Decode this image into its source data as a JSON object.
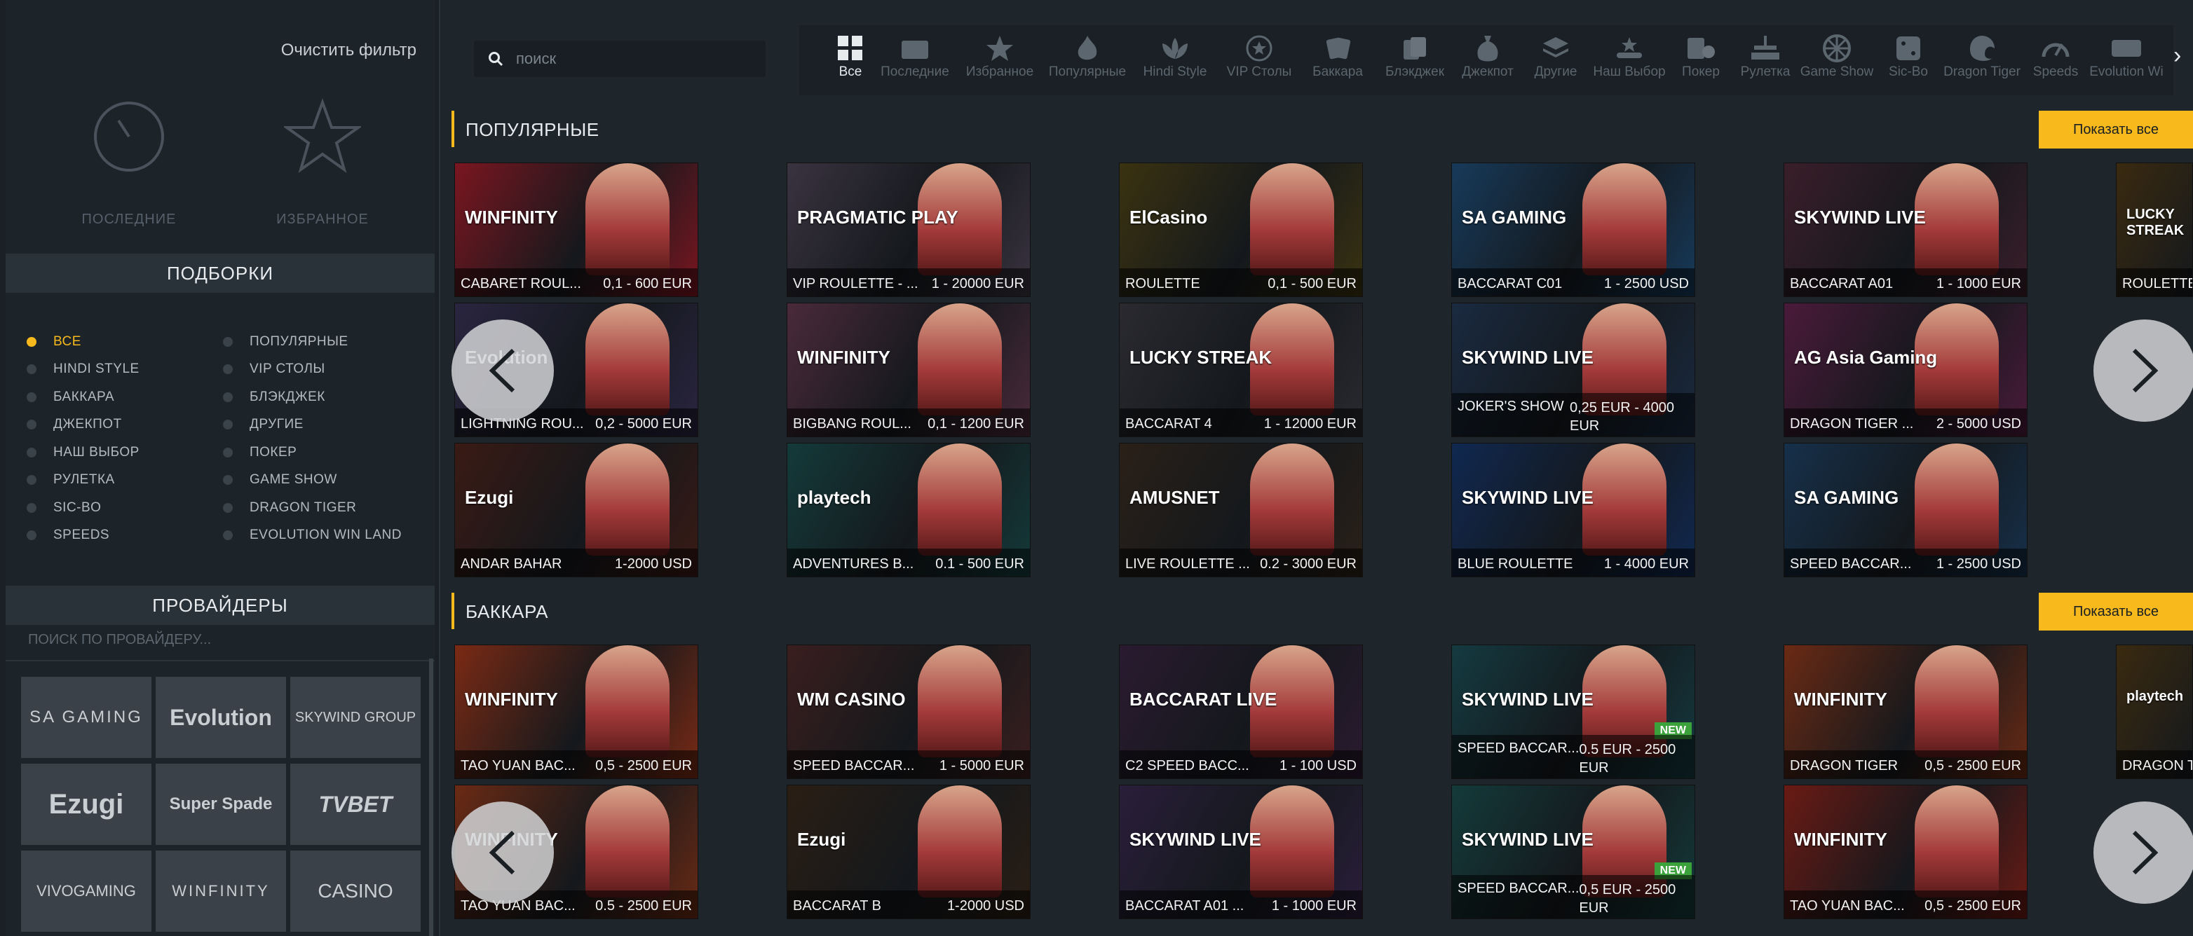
{
  "sidebar": {
    "clear_filter": "Очистить фильтр",
    "recent_label": "ПОСЛЕДНИЕ",
    "favorites_label": "ИЗБРАННОЕ",
    "collections_title": "ПОДБОРКИ",
    "collections_left": [
      "ВСЕ",
      "HINDI STYLE",
      "БАККАРА",
      "ДЖЕКПОТ",
      "НАШ ВЫБОР",
      "РУЛЕТКА",
      "SIC-BO",
      "SPEEDS"
    ],
    "collections_right": [
      "ПОПУЛЯРНЫЕ",
      "VIP СТОЛЫ",
      "БЛЭКДЖЕК",
      "ДРУГИЕ",
      "ПОКЕР",
      "GAME SHOW",
      "DRAGON TIGER",
      "EVOLUTION WIN LAND"
    ],
    "providers_title": "ПРОВАЙДЕРЫ",
    "providers_search_placeholder": "ПОИСК ПО ПРОВАЙДЕРУ...",
    "providers": [
      "SA GAMING",
      "Evolution",
      "SKYWIND GROUP",
      "Ezugi",
      "Super Spade",
      "TVBET",
      "VIVOGAMING",
      "WINFINITY",
      "CASINO"
    ]
  },
  "search": {
    "placeholder": "поиск"
  },
  "categories": [
    "Все",
    "Последние",
    "Избранное",
    "Популярные",
    "Hindi Style",
    "VIP Столы",
    "Баккара",
    "Блэкджек",
    "Джекпот",
    "Другие",
    "Наш Выбор",
    "Покер",
    "Рулетка",
    "Game Show",
    "Sic-Bo",
    "Dragon Tiger",
    "Speeds",
    "Evolution Wi"
  ],
  "sections": [
    {
      "title": "ПОПУЛЯРНЫЕ",
      "show_all": "Показать все",
      "tiles": [
        {
          "name": "CABARET ROUL...",
          "limits": "0,1 - 600 EUR",
          "provider": "WINFINITY",
          "bg": "#7a1620"
        },
        {
          "name": "VIP ROULETTE - ...",
          "limits": "1 - 20000 EUR",
          "provider": "PRAGMATIC PLAY",
          "bg": "#3a3340"
        },
        {
          "name": "ROULETTE",
          "limits": "0,1 - 500 EUR",
          "provider": "ElCasino",
          "bg": "#3a3210"
        },
        {
          "name": "BACCARAT C01",
          "limits": "1 - 2500 USD",
          "provider": "SA GAMING",
          "bg": "#173a5a"
        },
        {
          "name": "BACCARAT A01",
          "limits": "1 - 1000 EUR",
          "provider": "SKYWIND LIVE",
          "bg": "#3a1e2a"
        },
        {
          "name": "LIGHTNING ROU...",
          "limits": "0,2 - 5000 EUR",
          "provider": "Evolution",
          "bg": "#2a2540"
        },
        {
          "name": "BIGBANG ROUL...",
          "limits": "0,1 - 1200 EUR",
          "provider": "WINFINITY",
          "bg": "#4a2a3a"
        },
        {
          "name": "BACCARAT 4",
          "limits": "1 - 12000 EUR",
          "provider": "LUCKY STREAK",
          "bg": "#2a2a30"
        },
        {
          "name": "JOKER'S SHOW",
          "limits": "0,25 EUR - 4000 EUR",
          "provider": "SKYWIND LIVE",
          "bg": "#1a2a40"
        },
        {
          "name": "DRAGON TIGER ...",
          "limits": "2 - 5000 USD",
          "provider": "AG Asia Gaming",
          "bg": "#4a1a3a"
        },
        {
          "name": "ANDAR BAHAR",
          "limits": "1-2000 USD",
          "provider": "Ezugi",
          "bg": "#3a1a14"
        },
        {
          "name": "ADVENTURES B...",
          "limits": "0.1 - 500 EUR",
          "provider": "playtech",
          "bg": "#143a3a"
        },
        {
          "name": "LIVE ROULETTE ...",
          "limits": "0.2 - 3000 EUR",
          "provider": "AMUSNET",
          "bg": "#2a2018"
        },
        {
          "name": "BLUE ROULETTE",
          "limits": "1 - 4000 EUR",
          "provider": "SKYWIND LIVE",
          "bg": "#102850"
        },
        {
          "name": "SPEED BACCAR...",
          "limits": "1 - 2500 USD",
          "provider": "SA GAMING",
          "bg": "#16304a"
        }
      ]
    },
    {
      "title": "БАККАРА",
      "show_all": "Показать все",
      "tiles": [
        {
          "name": "TAO YUAN BAC...",
          "limits": "0,5 - 2500 EUR",
          "provider": "WINFINITY",
          "bg": "#7a2a14"
        },
        {
          "name": "SPEED BACCAR...",
          "limits": "1 - 5000 EUR",
          "provider": "WM CASINO",
          "bg": "#3a1e1e"
        },
        {
          "name": "C2 SPEED BACC...",
          "limits": "1 - 100 USD",
          "provider": "BACCARAT LIVE",
          "bg": "#2a1a30"
        },
        {
          "name": "SPEED BACCAR...",
          "limits": "0.5 EUR - 2500 EUR",
          "provider": "SKYWIND LIVE",
          "bg": "#143a40",
          "new": "NEW"
        },
        {
          "name": "DRAGON TIGER",
          "limits": "0,5 - 2500 EUR",
          "provider": "WINFINITY",
          "bg": "#6a2a14"
        },
        {
          "name": "TAO YUAN BAC...",
          "limits": "0.5 - 2500 EUR",
          "provider": "WINFINITY",
          "bg": "#6a2a14"
        },
        {
          "name": "BACCARAT B",
          "limits": "1-2000 USD",
          "provider": "Ezugi",
          "bg": "#2a1e14"
        },
        {
          "name": "BACCARAT A01 ...",
          "limits": "1 - 1000 EUR",
          "provider": "SKYWIND LIVE",
          "bg": "#2a1e3a"
        },
        {
          "name": "SPEED BACCAR...",
          "limits": "0,5 EUR - 2500 EUR",
          "provider": "SKYWIND LIVE",
          "bg": "#143a3a",
          "new": "NEW"
        },
        {
          "name": "TAO YUAN BAC...",
          "limits": "0,5 - 2500 EUR",
          "provider": "WINFINITY",
          "bg": "#6a1a14"
        }
      ]
    }
  ],
  "peek_tiles": [
    {
      "name": "ROULETTE",
      "provider": "LUCKY STREAK"
    },
    {
      "name": "DRAGON TI",
      "provider": "playtech"
    }
  ],
  "colors": {
    "accent": "#f7b91b",
    "bg": "#1e252b",
    "sidebar": "#1c2329"
  }
}
